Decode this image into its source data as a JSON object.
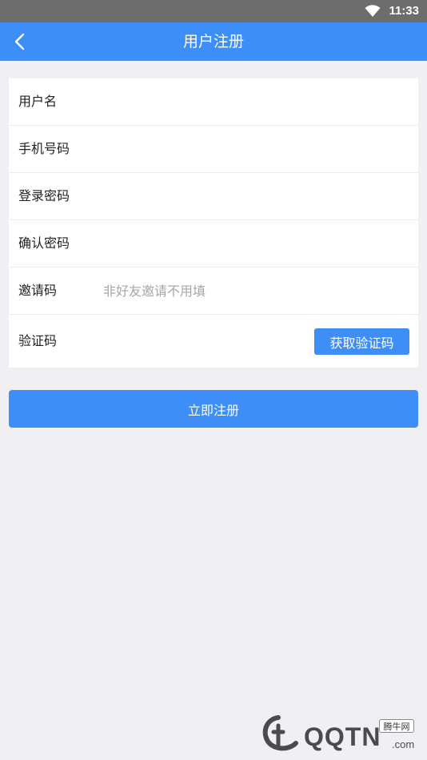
{
  "status_bar": {
    "time": "11:33",
    "wifi_icon": "wifi-icon"
  },
  "app_bar": {
    "back_icon": "chevron-left-icon",
    "title": "用户注册"
  },
  "form": {
    "fields": [
      {
        "label": "用户名",
        "value": "",
        "placeholder": ""
      },
      {
        "label": "手机号码",
        "value": "",
        "placeholder": ""
      },
      {
        "label": "登录密码",
        "value": "",
        "placeholder": ""
      },
      {
        "label": "确认密码",
        "value": "",
        "placeholder": ""
      },
      {
        "label": "邀请码",
        "value": "",
        "placeholder": "非好友邀请不用填"
      },
      {
        "label": "验证码",
        "value": "",
        "placeholder": ""
      }
    ],
    "get_code_button": "获取验证码"
  },
  "submit_button": "立即注册",
  "watermark": {
    "text": "QQTN",
    "suffix": ".com",
    "badge": "腾牛网"
  },
  "colors": {
    "primary": "#3e8ef7",
    "background": "#efeff4",
    "status_bar": "#6d6d6d"
  }
}
